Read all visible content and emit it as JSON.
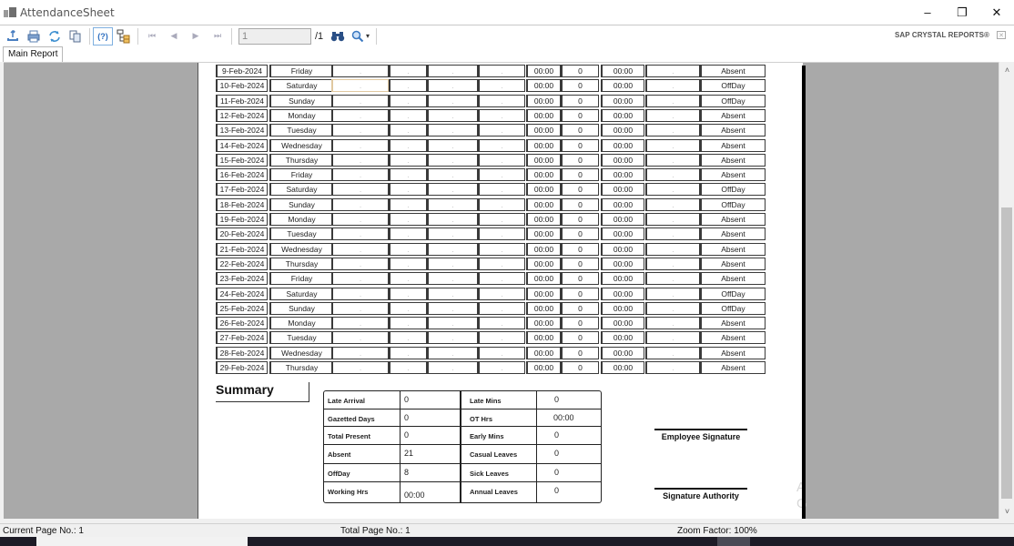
{
  "window": {
    "title": "AttendanceSheet",
    "controls": {
      "minimize": "–",
      "restore": "❐",
      "close": "✕"
    }
  },
  "toolbar": {
    "buttons": [
      {
        "name": "export-icon",
        "glyph": "⇧"
      },
      {
        "name": "print-icon",
        "glyph": "⎙"
      },
      {
        "name": "refresh-icon",
        "glyph": "↻"
      },
      {
        "name": "copy-icon",
        "glyph": "⧉"
      },
      {
        "name": "help-icon",
        "glyph": "(?)"
      },
      {
        "name": "group-tree-icon",
        "glyph": "⊞"
      }
    ],
    "nav": {
      "first": "⏮",
      "prev": "◀",
      "next": "▶",
      "last": "⏭"
    },
    "page_input_value": "1",
    "page_total": "/1",
    "find_glyph": "⌘",
    "zoom_glyph": "⌕",
    "zoom_dropdown": "▾",
    "brand": "SAP CRYSTAL REPORTS®",
    "brand_close": "✕"
  },
  "tabs": [
    {
      "label": "Main Report"
    }
  ],
  "attendance_rows": [
    {
      "date": "9-Feb-2024",
      "day": "Friday",
      "c1": ".",
      "c2": ".",
      "c3": ".",
      "c4": ".",
      "time1": "00:00",
      "count": "0",
      "time2": "00:00",
      "c5": ".",
      "status": "Absent"
    },
    {
      "date": "10-Feb-2024",
      "day": "Saturday",
      "c1": ".",
      "c2": ".",
      "c3": ".",
      "c4": ".",
      "time1": "00:00",
      "count": "0",
      "time2": "00:00",
      "c5": ".",
      "status": "OffDay"
    },
    {
      "date": "11-Feb-2024",
      "day": "Sunday",
      "c1": ".",
      "c2": ".",
      "c3": ".",
      "c4": ".",
      "time1": "00:00",
      "count": "0",
      "time2": "00:00",
      "c5": ".",
      "status": "OffDay"
    },
    {
      "date": "12-Feb-2024",
      "day": "Monday",
      "c1": ".",
      "c2": ".",
      "c3": ".",
      "c4": ".",
      "time1": "00:00",
      "count": "0",
      "time2": "00:00",
      "c5": ".",
      "status": "Absent"
    },
    {
      "date": "13-Feb-2024",
      "day": "Tuesday",
      "c1": ".",
      "c2": ".",
      "c3": ".",
      "c4": ".",
      "time1": "00:00",
      "count": "0",
      "time2": "00:00",
      "c5": ".",
      "status": "Absent"
    },
    {
      "date": "14-Feb-2024",
      "day": "Wednesday",
      "c1": ".",
      "c2": ".",
      "c3": ".",
      "c4": ".",
      "time1": "00:00",
      "count": "0",
      "time2": "00:00",
      "c5": ".",
      "status": "Absent"
    },
    {
      "date": "15-Feb-2024",
      "day": "Thursday",
      "c1": ".",
      "c2": ".",
      "c3": ".",
      "c4": ".",
      "time1": "00:00",
      "count": "0",
      "time2": "00:00",
      "c5": ".",
      "status": "Absent"
    },
    {
      "date": "16-Feb-2024",
      "day": "Friday",
      "c1": ".",
      "c2": ".",
      "c3": ".",
      "c4": ".",
      "time1": "00:00",
      "count": "0",
      "time2": "00:00",
      "c5": ".",
      "status": "Absent"
    },
    {
      "date": "17-Feb-2024",
      "day": "Saturday",
      "c1": ".",
      "c2": ".",
      "c3": ".",
      "c4": ".",
      "time1": "00:00",
      "count": "0",
      "time2": "00:00",
      "c5": ".",
      "status": "OffDay"
    },
    {
      "date": "18-Feb-2024",
      "day": "Sunday",
      "c1": ".",
      "c2": ".",
      "c3": ".",
      "c4": ".",
      "time1": "00:00",
      "count": "0",
      "time2": "00:00",
      "c5": ".",
      "status": "OffDay"
    },
    {
      "date": "19-Feb-2024",
      "day": "Monday",
      "c1": ".",
      "c2": ".",
      "c3": ".",
      "c4": ".",
      "time1": "00:00",
      "count": "0",
      "time2": "00:00",
      "c5": ".",
      "status": "Absent"
    },
    {
      "date": "20-Feb-2024",
      "day": "Tuesday",
      "c1": ".",
      "c2": ".",
      "c3": ".",
      "c4": ".",
      "time1": "00:00",
      "count": "0",
      "time2": "00:00",
      "c5": ".",
      "status": "Absent"
    },
    {
      "date": "21-Feb-2024",
      "day": "Wednesday",
      "c1": ".",
      "c2": ".",
      "c3": ".",
      "c4": ".",
      "time1": "00:00",
      "count": "0",
      "time2": "00:00",
      "c5": ".",
      "status": "Absent"
    },
    {
      "date": "22-Feb-2024",
      "day": "Thursday",
      "c1": ".",
      "c2": ".",
      "c3": ".",
      "c4": ".",
      "time1": "00:00",
      "count": "0",
      "time2": "00:00",
      "c5": ".",
      "status": "Absent"
    },
    {
      "date": "23-Feb-2024",
      "day": "Friday",
      "c1": ".",
      "c2": ".",
      "c3": ".",
      "c4": ".",
      "time1": "00:00",
      "count": "0",
      "time2": "00:00",
      "c5": ".",
      "status": "Absent"
    },
    {
      "date": "24-Feb-2024",
      "day": "Saturday",
      "c1": ".",
      "c2": ".",
      "c3": ".",
      "c4": ".",
      "time1": "00:00",
      "count": "0",
      "time2": "00:00",
      "c5": ".",
      "status": "OffDay"
    },
    {
      "date": "25-Feb-2024",
      "day": "Sunday",
      "c1": ".",
      "c2": ".",
      "c3": ".",
      "c4": ".",
      "time1": "00:00",
      "count": "0",
      "time2": "00:00",
      "c5": ".",
      "status": "OffDay"
    },
    {
      "date": "26-Feb-2024",
      "day": "Monday",
      "c1": ".",
      "c2": ".",
      "c3": ".",
      "c4": ".",
      "time1": "00:00",
      "count": "0",
      "time2": "00:00",
      "c5": ".",
      "status": "Absent"
    },
    {
      "date": "27-Feb-2024",
      "day": "Tuesday",
      "c1": ".",
      "c2": ".",
      "c3": ".",
      "c4": ".",
      "time1": "00:00",
      "count": "0",
      "time2": "00:00",
      "c5": ".",
      "status": "Absent"
    },
    {
      "date": "28-Feb-2024",
      "day": "Wednesday",
      "c1": ".",
      "c2": ".",
      "c3": ".",
      "c4": ".",
      "time1": "00:00",
      "count": "0",
      "time2": "00:00",
      "c5": ".",
      "status": "Absent"
    },
    {
      "date": "29-Feb-2024",
      "day": "Thursday",
      "c1": ".",
      "c2": ".",
      "c3": ".",
      "c4": ".",
      "time1": "00:00",
      "count": "0",
      "time2": "00:00",
      "c5": ".",
      "status": "Absent"
    }
  ],
  "summary": {
    "title": "Summary",
    "left": [
      {
        "label": "Late   Arrival",
        "value": "0"
      },
      {
        "label": "Gazetted Days",
        "value": "0"
      },
      {
        "label": "Total Present",
        "value": "0"
      },
      {
        "label": "Absent",
        "value": "21"
      },
      {
        "label": "OffDay",
        "value": "8"
      },
      {
        "label": "Working Hrs",
        "value": "00:00"
      }
    ],
    "right": [
      {
        "label": "Late Mins",
        "value": "0"
      },
      {
        "label": "OT Hrs",
        "value": "00:00"
      },
      {
        "label": "Early Mins",
        "value": "0"
      },
      {
        "label": "Casual Leaves",
        "value": "0"
      },
      {
        "label": "Sick Leaves",
        "value": "0"
      },
      {
        "label": "Annual Leaves",
        "value": "0"
      }
    ]
  },
  "signatures": {
    "employee": "Employee Signature",
    "authority": "Signature Authority"
  },
  "watermark": "A\nG",
  "statusbar": {
    "current_page": "Current Page No.: 1",
    "total_page": "Total Page No.: 1",
    "zoom_factor": "Zoom Factor: 100%"
  },
  "scrollbar": {
    "up": "˄",
    "down": "˅"
  }
}
